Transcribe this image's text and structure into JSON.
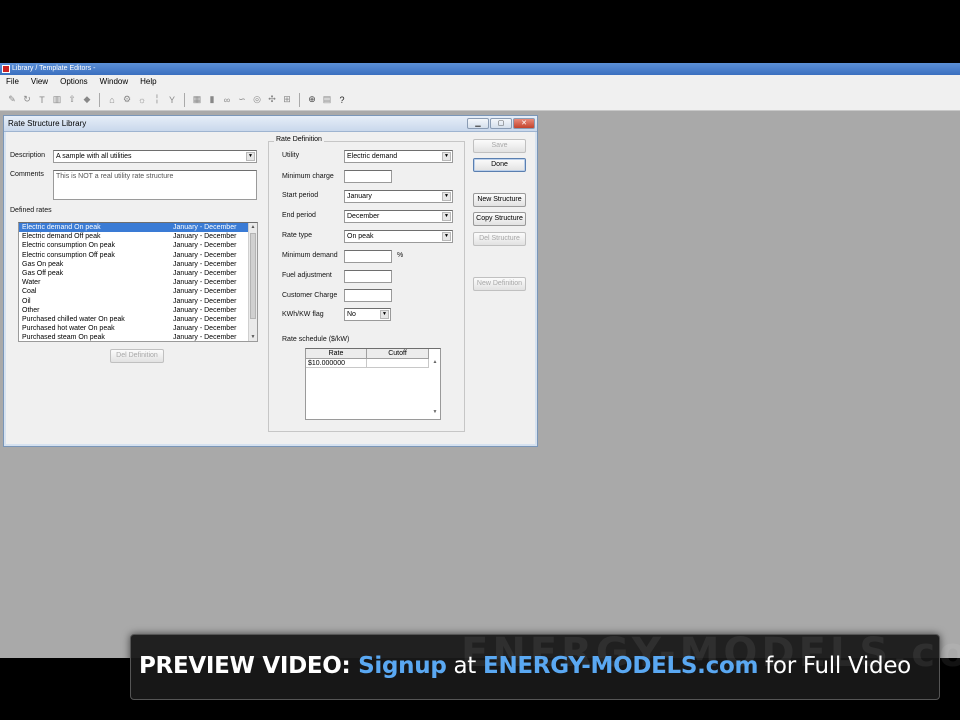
{
  "app": {
    "title": "Library / Template Editors -",
    "menu": [
      "File",
      "View",
      "Options",
      "Window",
      "Help"
    ]
  },
  "dialog": {
    "title": "Rate Structure Library",
    "description_label": "Description",
    "description_value": "A sample with all utilities",
    "comments_label": "Comments",
    "comments_value": "This is NOT a real utility rate structure",
    "defined_rates_label": "Defined rates",
    "defined_rates": [
      {
        "name": "Electric demand On peak",
        "period": "January - December",
        "selected": true
      },
      {
        "name": "Electric demand Off peak",
        "period": "January - December"
      },
      {
        "name": "Electric consumption On peak",
        "period": "January - December"
      },
      {
        "name": "Electric consumption Off peak",
        "period": "January - December"
      },
      {
        "name": "Gas On peak",
        "period": "January - December"
      },
      {
        "name": "Gas Off peak",
        "period": "January - December"
      },
      {
        "name": "Water",
        "period": "January - December"
      },
      {
        "name": "Coal",
        "period": "January - December"
      },
      {
        "name": "Oil",
        "period": "January - December"
      },
      {
        "name": "Other",
        "period": "January - December"
      },
      {
        "name": "Purchased chilled water On peak",
        "period": "January - December"
      },
      {
        "name": "Purchased hot water On peak",
        "period": "January - December"
      },
      {
        "name": "Purchased steam On peak",
        "period": "January - December"
      }
    ],
    "del_definition_label": "Del Definition",
    "rate_definition": {
      "legend": "Rate Definition",
      "utility_label": "Utility",
      "utility_value": "Electric demand",
      "minimum_charge_label": "Minimum charge",
      "minimum_charge_value": "",
      "start_period_label": "Start period",
      "start_period_value": "January",
      "end_period_label": "End period",
      "end_period_value": "December",
      "rate_type_label": "Rate type",
      "rate_type_value": "On peak",
      "minimum_demand_label": "Minimum demand",
      "minimum_demand_unit": "%",
      "fuel_adjustment_label": "Fuel adjustment",
      "customer_charge_label": "Customer Charge",
      "kwh_kw_flag_label": "KWh/KW flag",
      "kwh_kw_flag_value": "No",
      "rate_schedule_label": "Rate schedule ($/kW)",
      "grid_headers": [
        "Rate",
        "Cutoff"
      ],
      "grid_rows": [
        [
          "$10.000000",
          ""
        ]
      ]
    },
    "buttons": {
      "save": "Save",
      "done": "Done",
      "new_structure": "New Structure",
      "copy_structure": "Copy Structure",
      "del_structure": "Del Structure",
      "new_definition": "New Definition"
    }
  },
  "banner": {
    "preview": "PREVIEW VIDEO",
    "colon": ": ",
    "signup": "Signup",
    "at": " at ",
    "site": "ENERGY-MODELS.com",
    "tail": " for Full Video",
    "watermark": "ENERGY-MODELS.com"
  },
  "colors": {
    "accent": "#3a7bd5",
    "banner_link": "#5aa8f2",
    "workspace": "#a9a9a9"
  }
}
